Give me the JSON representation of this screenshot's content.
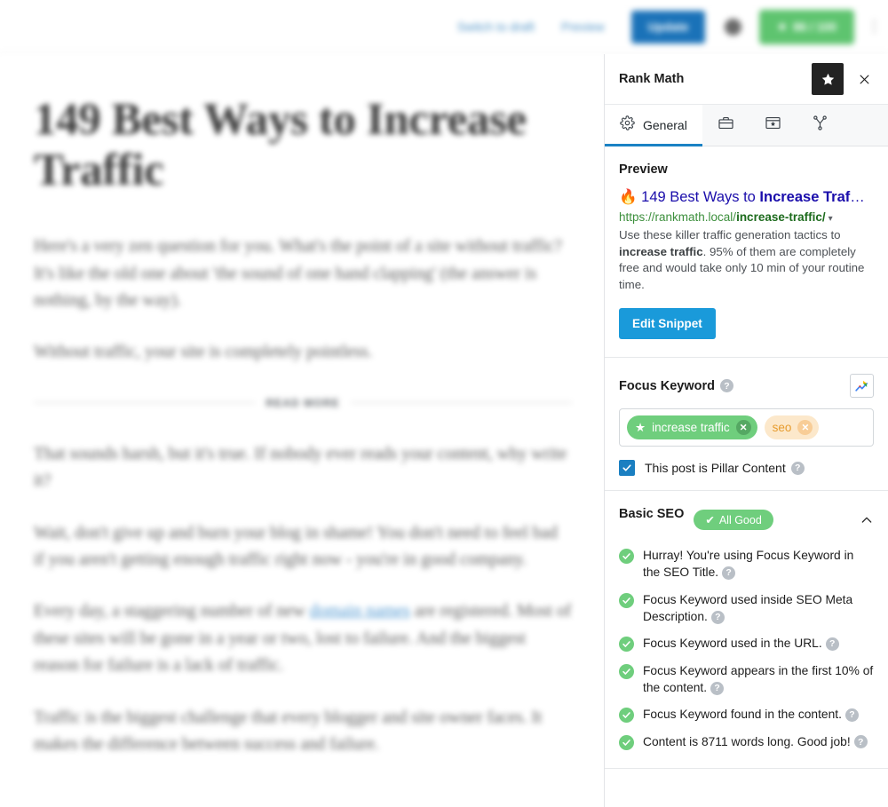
{
  "toolbar": {
    "switch_to_draft": "Switch to draft",
    "preview": "Preview",
    "update": "Update",
    "seo_score": "86 / 100",
    "score_icon": "trophy-icon",
    "options_icon": "kebab-menu-icon",
    "settings_icon": "settings-dot-icon"
  },
  "editor": {
    "post_title": "149 Best Ways to Increase Traffic",
    "paragraphs": [
      "Here's a very zen question for you. What's the point of a site without traffic? It's like the old one about 'the sound of one hand clapping' (the answer is nothing, by the way).",
      "Without traffic, your site is completely pointless."
    ],
    "read_more_label": "READ MORE",
    "paragraphs_after": [
      "That sounds harsh, but it's true. If nobody ever reads your content, why write it?",
      "Wait, don't give up and burn your blog in shame! You don't need to feel bad if you aren't getting enough traffic right now - you're in good company.",
      "Traffic is the biggest challenge that every blogger and site owner faces. It makes the difference between success and failure."
    ],
    "link_paragraph": {
      "before": "Every day, a staggering number of new ",
      "link": "domain names",
      "after": " are registered. Most of these sites will be gone in a year or two, lost to failure. And the biggest reason for failure is a lack of traffic."
    }
  },
  "panel": {
    "title": "Rank Math",
    "star_icon": "star-icon",
    "close_icon": "close-icon",
    "tabs": [
      {
        "label": "General",
        "icon": "gear-icon",
        "active": true
      },
      {
        "label": "",
        "icon": "briefcase-icon",
        "active": false
      },
      {
        "label": "",
        "icon": "schema-browser-icon",
        "active": false
      },
      {
        "label": "",
        "icon": "social-share-icon",
        "active": false
      }
    ]
  },
  "preview": {
    "section_title": "Preview",
    "fire_emoji": "🔥",
    "title_plain": "149 Best Ways to ",
    "title_bold": "Increase Traf",
    "title_ellipsis": "…",
    "url_host": "https://rankmath.local/",
    "url_slug": "increase-traffic/",
    "url_caret": "▾",
    "desc_part1": "Use these killer traffic generation tactics to ",
    "desc_bold": "increase traffic",
    "desc_part2": ". 95% of them are completely free and would take only 10 min of your routine time.",
    "edit_snippet_label": "Edit Snippet"
  },
  "focus_keyword": {
    "section_title": "Focus Keyword",
    "help_glyph": "?",
    "trend_icon": "google-trends-icon",
    "keywords": [
      {
        "label": "increase traffic",
        "primary": true,
        "star": "★",
        "remove": "✕"
      },
      {
        "label": "seo",
        "primary": false,
        "remove": "✕"
      }
    ],
    "pillar_label": "This post is Pillar Content",
    "pillar_checked": true,
    "checkmark_glyph": "✓"
  },
  "basic_seo": {
    "section_title": "Basic SEO",
    "badge_label": "All Good",
    "badge_check": "✔",
    "collapse_icon": "chevron-up-icon",
    "items": [
      "Hurray! You're using Focus Keyword in the SEO Title.",
      "Focus Keyword used inside SEO Meta Description.",
      "Focus Keyword used in the URL.",
      "Focus Keyword appears in the first 10% of the content.",
      "Focus Keyword found in the content.",
      "Content is 8711 words long. Good job!"
    ]
  },
  "colors": {
    "accent_blue": "#1a82c4",
    "update_blue": "#1a72b8",
    "snippet_blue": "#1a9ada",
    "green": "#6fce7d",
    "orange": "#e79c2e",
    "link_blue": "#1a0dab",
    "url_green": "#3c8f3c"
  }
}
